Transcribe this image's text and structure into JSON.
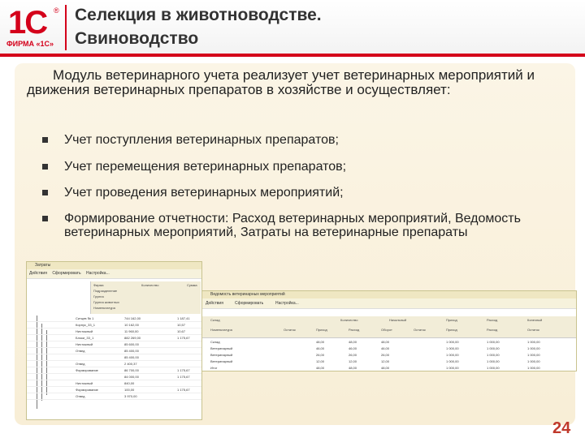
{
  "logo": {
    "mark": "1С",
    "registered": "®",
    "firm": "ФИРМА «1С»"
  },
  "title": {
    "line1": "Селекция в животноводстве.",
    "line2": "Свиноводство"
  },
  "intro": "Модуль ветеринарного учета реализует учет ветеринарных мероприятий и движения ветеринарных препаратов в хозяйстве и осуществляет:",
  "bullets": [
    "Учет поступления ветеринарных препаратов;",
    "Учет перемещения ветеринарных препаратов;",
    "Учет проведения ветеринарных мероприятий;",
    "Формирование отчетности: Расход ветеринарных мероприятий, Ведомость ветеринарных мероприятий, Затраты на ветеринарные препараты"
  ],
  "screenshot1": {
    "title": "Затраты",
    "toolbar": [
      "Действия",
      "Сформировать",
      "Настройка..."
    ],
    "header": [
      "Фирма",
      "Подразделение",
      "Группа",
      "Группа животных",
      "Номенклатура"
    ],
    "columns": [
      "Количество",
      "Сумма"
    ],
    "rows": [
      {
        "name": "Ситцев № 1",
        "qty": "744 162,00",
        "sum": "1 187,41"
      },
      {
        "name": "Корпус_33_1",
        "qty": "10 162,00",
        "sum": "10,57"
      },
      {
        "name": "Ничтожный",
        "qty": "11 960,00",
        "sum": "10,67"
      },
      {
        "name": "Блоки_33_1",
        "qty": "882 269,00",
        "sum": "1 175,67"
      },
      {
        "name": "Ничтожный",
        "qty": "85 600,00",
        "sum": ""
      },
      {
        "name": "Отвед",
        "qty": "85 400,00",
        "sum": ""
      },
      {
        "name": "",
        "qty": "85 400,00",
        "sum": ""
      },
      {
        "name": "Отвед",
        "qty": "2 400,37",
        "sum": ""
      },
      {
        "name": "Формирование",
        "qty": "86 700,00",
        "sum": "1 175,67"
      },
      {
        "name": "",
        "qty": "84 000,00",
        "sum": "1 175,67"
      },
      {
        "name": "Ничтожный",
        "qty": "840,00",
        "sum": ""
      },
      {
        "name": "Формирование",
        "qty": "100,00",
        "sum": "1 175,67"
      },
      {
        "name": "Отвед",
        "qty": "3 970,00",
        "sum": ""
      }
    ]
  },
  "screenshot2": {
    "title": "Ведомость ветеринарных мероприятий",
    "toolbar": [
      "Действия",
      "Сформировать",
      "Настройка..."
    ],
    "header_top": [
      "Склад",
      "Количество",
      "Начальный",
      "Приход",
      "Расход",
      "Конечный"
    ],
    "header_cols": [
      "Номенклатура",
      "Остаток",
      "Приход",
      "Расход",
      "Оборот",
      "Остаток",
      "Приход",
      "Расход",
      "Остаток"
    ],
    "rows": [
      [
        "Склад",
        "",
        "48,00",
        "48,00",
        "48,00",
        "",
        "1 000,00",
        "1 000,00",
        "1 000,00"
      ],
      [
        "Ветеринарный",
        "",
        "46,00",
        "46,00",
        "46,00",
        "",
        "1 000,00",
        "1 000,00",
        "1 000,00"
      ],
      [
        "Ветеринарный",
        "",
        "26,00",
        "26,00",
        "26,00",
        "",
        "1 000,00",
        "1 000,00",
        "1 000,00"
      ],
      [
        "Ветеринарный",
        "",
        "12,00",
        "12,00",
        "12,00",
        "",
        "1 000,00",
        "1 000,00",
        "1 000,00"
      ],
      [
        "Итог",
        "",
        "48,00",
        "48,00",
        "48,00",
        "",
        "1 000,00",
        "1 000,00",
        "1 000,00"
      ]
    ]
  },
  "page_number": "24",
  "colors": {
    "brand_red": "#d4001a",
    "panel_bg": "#f8eed6",
    "title_text": "#333333"
  }
}
